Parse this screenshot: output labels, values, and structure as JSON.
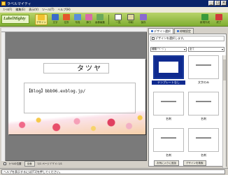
{
  "window": {
    "title": "ラベルマイティ"
  },
  "menu": [
    "ﾌｧｲﾙ(F)",
    "編集(E)",
    "表示(V)",
    "ツール(T)",
    "ヘルプ(H)"
  ],
  "toolbar": {
    "logo": "LabelMighty",
    "buttons": [
      {
        "label": "デザイン",
        "color": "#f2c230"
      },
      {
        "label": "文字",
        "color": "#3a6bc9"
      },
      {
        "label": "住所"
      },
      {
        "label": "写真"
      },
      {
        "label": "飾り"
      },
      {
        "label": "画像編集"
      },
      {
        "label": "一覧"
      },
      {
        "label": "印刷"
      },
      {
        "label": "保存"
      }
    ],
    "right_buttons": [
      {
        "label": "新規作成"
      },
      {
        "label": "終了"
      }
    ]
  },
  "card": {
    "name": "タツヤ",
    "url": "【Blog】bbb96.exblog.jp/"
  },
  "editor_status": {
    "checkbox_label": "ｶｰｿﾙの位置",
    "zoom": "全面",
    "page_info": "1/1 ページ  ﾃﾞｻﾞｲﾝ 1/1"
  },
  "side": {
    "tabs": [
      {
        "label": "デザイン選択"
      },
      {
        "label": "枠線設定"
      }
    ],
    "hint": "デザインを選択します。",
    "filters": [
      "種類 ｢ﾍﾟｰｼﾞ」",
      "全て"
    ],
    "templates": [
      {
        "caption": "テンプレートなし",
        "selected": true
      },
      {
        "caption": "文字のみ",
        "selected": false
      },
      {
        "caption": "名刺",
        "selected": false
      },
      {
        "caption": "名刺",
        "selected": false
      },
      {
        "caption": "名刺",
        "selected": false
      },
      {
        "caption": "名刺",
        "selected": false
      }
    ],
    "footer_buttons": [
      "お気に入りに追加",
      "デザインを検索"
    ]
  },
  "statusbar": {
    "text": "ヘルプを表示するには[F1]を押してください。"
  }
}
